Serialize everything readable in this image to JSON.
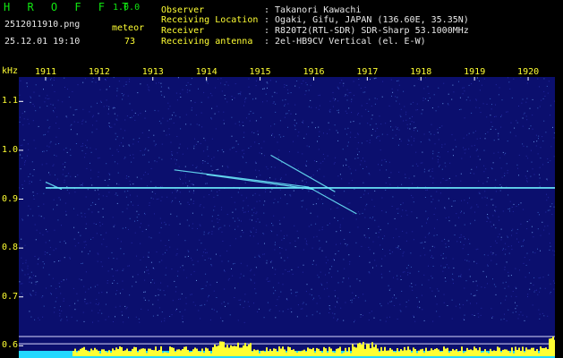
{
  "header": {
    "app_name": "H R O F F T",
    "version": "1.0.0",
    "filename": "2512011910.png",
    "mode_label": "meteor",
    "datetime": "25.12.01 19:10",
    "count": "73",
    "observer_key": "Observer",
    "observer_val": ": Takanori Kawachi",
    "location_key": "Receiving Location",
    "location_val": ": Ogaki, Gifu, JAPAN (136.60E, 35.35N)",
    "receiver_key": "Receiver",
    "receiver_val": ": R820T2(RTL-SDR) SDR-Sharp 53.1000MHz",
    "antenna_key": "Receiving antenna",
    "antenna_val": ": 2el-HB9CV Vertical (el. E-W)"
  },
  "colors": {
    "background": "#0b0f6e",
    "label": "#ffff33",
    "title": "#11e611",
    "signal": "#6ff0ff",
    "spectrum": "#ffff33",
    "baseline": "#22d8ff"
  },
  "chart_data": {
    "type": "heatmap",
    "ylabel": "kHz",
    "x_ticks": [
      "1911",
      "1912",
      "1913",
      "1914",
      "1915",
      "1916",
      "1917",
      "1918",
      "1919",
      "1920"
    ],
    "y_ticks": [
      "1.1",
      "1.0",
      "0.9",
      "0.8",
      "0.7",
      "0.6"
    ],
    "x_range": [
      1910.5,
      1920.5
    ],
    "y_range": [
      0.575,
      1.15
    ],
    "carrier_khz": 0.923,
    "meteor_traces": [
      {
        "x": [
          1913.4,
          1915.9,
          1916.8
        ],
        "y": [
          0.96,
          0.925,
          0.87
        ]
      },
      {
        "x": [
          1915.2,
          1916.4
        ],
        "y": [
          0.99,
          0.915
        ]
      },
      {
        "x": [
          1914.0,
          1916.0
        ],
        "y": [
          0.95,
          0.92
        ]
      },
      {
        "x": [
          1911.0,
          1911.3
        ],
        "y": [
          0.935,
          0.92
        ]
      }
    ],
    "reference_lines_khz": [
      0.619,
      0.604
    ]
  }
}
